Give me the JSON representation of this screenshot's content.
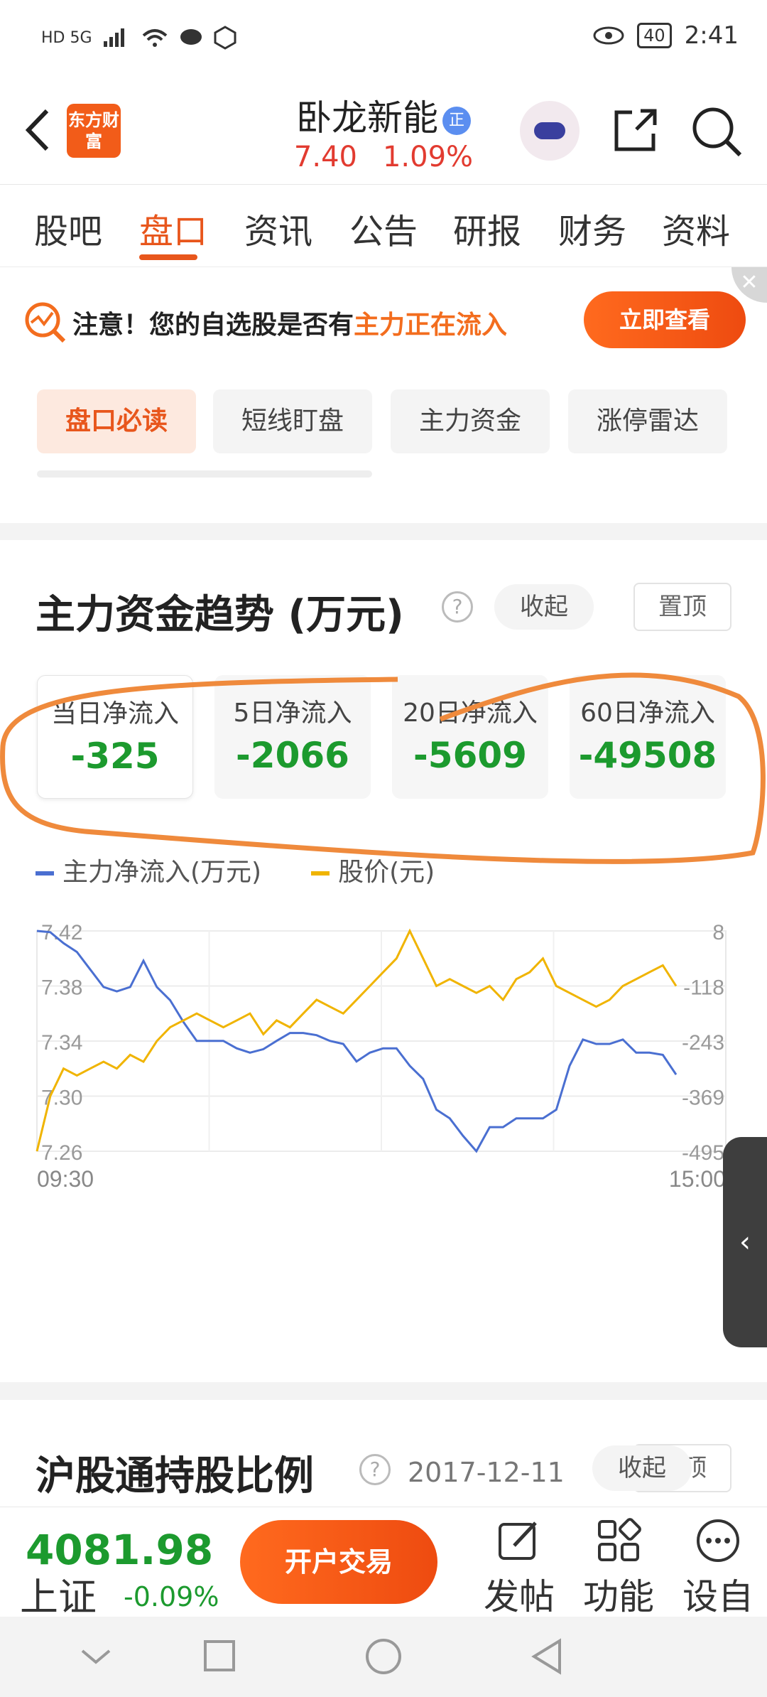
{
  "status_bar": {
    "network": "HD 5G",
    "battery": "40",
    "time": "2:41"
  },
  "header": {
    "logo_text": "东方财富",
    "stock_name": "卧龙新能",
    "badge": "正",
    "price": "7.40",
    "change_pct": "1.09%"
  },
  "tabs": [
    "股吧",
    "盘口",
    "资讯",
    "公告",
    "研报",
    "财务",
    "资料"
  ],
  "notice": {
    "prefix": "注意！您的自选股是否有",
    "highlight": "主力正在流入",
    "button": "立即查看",
    "close": "✕"
  },
  "subtabs": [
    "盘口必读",
    "短线盯盘",
    "主力资金",
    "涨停雷达"
  ],
  "fund_trend": {
    "title": "主力资金趋势 (万元)",
    "help": "?",
    "collapse": "收起",
    "pin": "置顶",
    "flows": [
      {
        "label": "当日净流入",
        "value": "-325"
      },
      {
        "label": "5日净流入",
        "value": "-2066"
      },
      {
        "label": "20日净流入",
        "value": "-5609"
      },
      {
        "label": "60日净流入",
        "value": "-49508"
      }
    ],
    "legend": {
      "flow": "主力净流入(万元)",
      "price": "股价(元)"
    }
  },
  "chart_data": {
    "type": "line",
    "x_labels": [
      "09:30",
      "15:00"
    ],
    "y_left_ticks": [
      "7.42",
      "7.38",
      "7.34",
      "7.30",
      "7.26"
    ],
    "y_right_ticks": [
      "8",
      "-118",
      "-243",
      "-369",
      "-495"
    ],
    "y_left_range": [
      7.26,
      7.42
    ],
    "y_right_range": [
      -495,
      8
    ],
    "series": [
      {
        "name": "主力净流入(万元)",
        "axis": "right",
        "color": "#4a6fd1",
        "values": [
          8,
          5,
          -20,
          -40,
          -80,
          -120,
          -130,
          -120,
          -60,
          -120,
          -150,
          -200,
          -243,
          -243,
          -243,
          -260,
          -270,
          -262,
          -243,
          -225,
          -225,
          -230,
          -243,
          -250,
          -290,
          -270,
          -260,
          -260,
          -300,
          -330,
          -400,
          -420,
          -460,
          -495,
          -440,
          -440,
          -420,
          -420,
          -420,
          -400,
          -300,
          -240,
          -250,
          -250,
          -240,
          -270,
          -270,
          -275,
          -320
        ]
      },
      {
        "name": "股价(元)",
        "axis": "left",
        "color": "#f0b400",
        "values": [
          7.26,
          7.3,
          7.32,
          7.315,
          7.32,
          7.325,
          7.32,
          7.33,
          7.325,
          7.34,
          7.35,
          7.355,
          7.36,
          7.355,
          7.35,
          7.355,
          7.36,
          7.345,
          7.355,
          7.35,
          7.36,
          7.37,
          7.365,
          7.36,
          7.37,
          7.38,
          7.39,
          7.4,
          7.42,
          7.4,
          7.38,
          7.385,
          7.38,
          7.375,
          7.38,
          7.37,
          7.385,
          7.39,
          7.4,
          7.38,
          7.375,
          7.37,
          7.365,
          7.37,
          7.38,
          7.385,
          7.39,
          7.395,
          7.38
        ]
      }
    ]
  },
  "hsgt": {
    "title": "沪股通持股比例",
    "help": "?",
    "date": "2017-12-11",
    "collapse": "收起",
    "pin": "置顶"
  },
  "bottom": {
    "index_value": "4081.98",
    "index_name": "上证",
    "index_change": "-0.09%",
    "open_button": "开户交易",
    "tools": [
      "发帖",
      "功能",
      "设自"
    ]
  },
  "side_handle": "‹"
}
